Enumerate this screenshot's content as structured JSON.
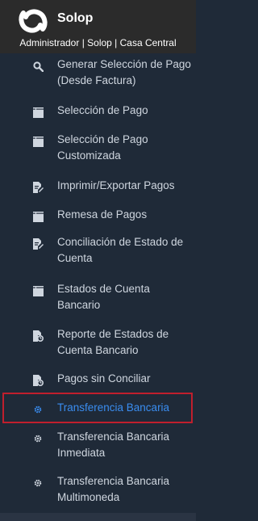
{
  "header": {
    "app_name": "Solop",
    "subtitle": "Administrador | Solop | Casa Central"
  },
  "colors": {
    "header_bg": "#2b2b2b",
    "sidebar_bg": "#1f2a38",
    "text": "#cfd6df",
    "active_text": "#3a8df0",
    "highlight_border": "#c01f2d"
  },
  "menu": {
    "items": [
      {
        "label": "Generar Selección de Pago (Desde Factura)",
        "icon": "search-icon"
      },
      {
        "label": "Selección de Pago",
        "icon": "window-icon"
      },
      {
        "label": "Selección de Pago Customizada",
        "icon": "window-icon"
      },
      {
        "label": "Imprimir/Exportar Pagos",
        "icon": "edit-document-icon"
      },
      {
        "label": "Remesa de Pagos",
        "icon": "window-icon"
      },
      {
        "label": "Conciliación de Estado de Cuenta",
        "icon": "edit-document-icon"
      },
      {
        "label": "Estados de Cuenta Bancario",
        "icon": "window-icon"
      },
      {
        "label": "Reporte de Estados de Cuenta Bancario",
        "icon": "report-icon"
      },
      {
        "label": "Pagos sin Conciliar",
        "icon": "report-icon"
      },
      {
        "label": "Transferencia Bancaria",
        "icon": "gear-icon",
        "active": true
      },
      {
        "label": "Transferencia Bancaria Inmediata",
        "icon": "gear-icon"
      },
      {
        "label": "Transferencia Bancaria Multimoneda",
        "icon": "gear-icon"
      }
    ]
  }
}
